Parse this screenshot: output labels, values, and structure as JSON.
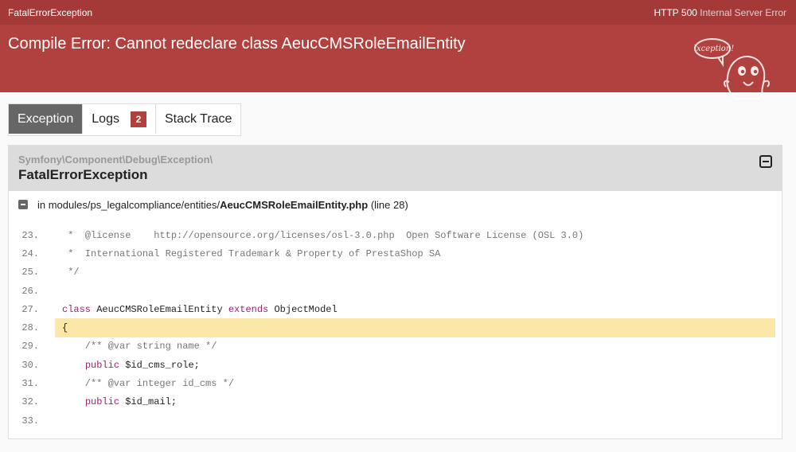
{
  "topbar": {
    "exception_type": "FatalErrorException",
    "http_code": "HTTP 500",
    "http_status": "Internal Server Error"
  },
  "header": {
    "title": "Compile Error: Cannot redeclare class AeucCMSRoleEmailEntity",
    "mascot_icon": "exception-ghost-icon",
    "mascot_bubble": "Exception!"
  },
  "tabs": [
    {
      "label": "Exception",
      "active": true
    },
    {
      "label": "Logs",
      "badge": "2",
      "active": false
    },
    {
      "label": "Stack Trace",
      "active": false
    }
  ],
  "exception": {
    "namespace": "Symfony\\Component\\Debug\\Exception\\",
    "class": "FatalErrorException",
    "file_prefix": "in modules/ps_legalcompliance/entities/",
    "file_name": "AeucCMSRoleEmailEntity.php",
    "line_info": "(line 28)"
  },
  "code_lines": [
    {
      "num": "23.",
      "text": " *  @license    http://opensource.org/licenses/osl-3.0.php  Open Software License (OSL 3.0)"
    },
    {
      "num": "24.",
      "text": " *  International Registered Trademark & Property of PrestaShop SA"
    },
    {
      "num": "25.",
      "text": " */"
    },
    {
      "num": "26.",
      "text": ""
    },
    {
      "num": "27.",
      "text": "class AeucCMSRoleEmailEntity extends ObjectModel"
    },
    {
      "num": "28.",
      "text": "{"
    },
    {
      "num": "29.",
      "text": "    /** @var string name */"
    },
    {
      "num": "30.",
      "text": "    public $id_cms_role;"
    },
    {
      "num": "31.",
      "text": "    /** @var integer id_cms */"
    },
    {
      "num": "32.",
      "text": "    public $id_mail;"
    },
    {
      "num": "33.",
      "text": ""
    }
  ],
  "highlight_line": "28.",
  "colors": {
    "topbar": "#a33a38",
    "header": "#b0413e",
    "highlight": "#fbe7a7",
    "keyword": "#a0226e"
  }
}
